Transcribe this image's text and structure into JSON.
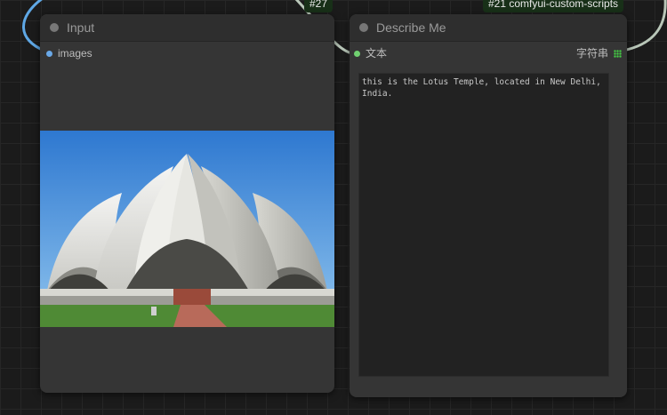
{
  "badges": {
    "left": "#27",
    "right": "#21 comfyui-custom-scripts"
  },
  "input_node": {
    "title": "Input",
    "output_label": "images",
    "image_alt": "Lotus Temple"
  },
  "describe_node": {
    "title": "Describe Me",
    "input_label": "文本",
    "output_type": "字符串",
    "text_value": "this is the Lotus Temple, located in New Delhi, India."
  },
  "colors": {
    "canvas": "#1b1b1b",
    "node_body": "#353535",
    "images_slot": "#6aa9e8",
    "text_slot": "#70d070",
    "grip": "#44cc44",
    "wire_blue": "#5fa8e6",
    "wire_gray": "#b9c7b9"
  }
}
